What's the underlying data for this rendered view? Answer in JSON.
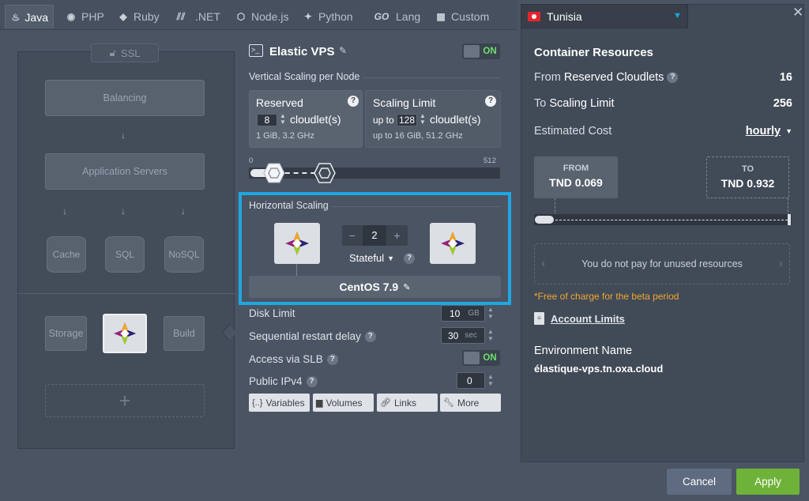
{
  "tabs": [
    {
      "label": "Java",
      "icon": "java-icon",
      "glyph": "♨"
    },
    {
      "label": "PHP",
      "icon": "php-icon",
      "glyph": "🐘"
    },
    {
      "label": "Ruby",
      "icon": "ruby-icon",
      "glyph": "◆"
    },
    {
      "label": ".NET",
      "icon": "dotnet-icon",
      "glyph": "⫽"
    },
    {
      "label": "Node.js",
      "icon": "nodejs-icon",
      "glyph": "⬡"
    },
    {
      "label": "Python",
      "icon": "python-icon",
      "glyph": "⚕"
    },
    {
      "label": "Lang",
      "icon": "go-icon",
      "glyph": "GO"
    },
    {
      "label": "Custom",
      "icon": "custom-icon",
      "glyph": "▦"
    }
  ],
  "topology": {
    "ssl": "SSL",
    "balancing": "Balancing",
    "app_servers": "Application Servers",
    "cache": "Cache",
    "sql": "SQL",
    "nosql": "NoSQL",
    "storage": "Storage",
    "build": "Build",
    "add": "+"
  },
  "node": {
    "title": "Elastic VPS",
    "toggle": "ON",
    "vertical_label": "Vertical Scaling per Node",
    "reserved": {
      "title": "Reserved",
      "value": "8",
      "unit": "cloudlet(s)",
      "info": "1 GiB, 3.2 GHz"
    },
    "limit": {
      "title": "Scaling Limit",
      "prefix": "up to",
      "value": "128",
      "unit": "cloudlet(s)",
      "info": "up to 16 GiB, 51.2 GHz"
    },
    "slider_min": "0",
    "slider_max": "512",
    "horizontal_label": "Horizontal Scaling",
    "count": "2",
    "minus": "−",
    "plus": "+",
    "mode": "Stateful",
    "os": "CentOS 7.9",
    "disk_label": "Disk Limit",
    "disk_value": "10",
    "disk_unit": "GB",
    "restart_label": "Sequential restart delay",
    "restart_value": "30",
    "restart_unit": "sec",
    "slb_label": "Access via SLB",
    "slb_toggle": "ON",
    "ipv4_label": "Public IPv4",
    "ipv4_value": "0",
    "buttons": {
      "variables": "Variables",
      "volumes": "Volumes",
      "links": "Links",
      "more": "More"
    }
  },
  "right": {
    "region": "Tunisia",
    "section_title": "Container Resources",
    "reserved_prefix": "From",
    "reserved_label": "Reserved Cloudlets",
    "reserved_value": "16",
    "limit_prefix": "To",
    "limit_label": "Scaling Limit",
    "limit_value": "256",
    "cost_label": "Estimated Cost",
    "cost_period": "hourly",
    "from_label": "FROM",
    "from_value": "TND 0.069",
    "to_label": "TO",
    "to_value": "TND 0.932",
    "unused_note": "You do not pay for unused resources",
    "beta_note": "*Free of charge for the beta period",
    "account_limits": "Account Limits",
    "env_label": "Environment Name",
    "env_value": "élastique-vps.tn.oxa.cloud"
  },
  "footer": {
    "cancel": "Cancel",
    "apply": "Apply"
  },
  "colors": {
    "accent": "#1ea7e1",
    "apply": "#6fb23a",
    "on": "#6ee06e"
  }
}
